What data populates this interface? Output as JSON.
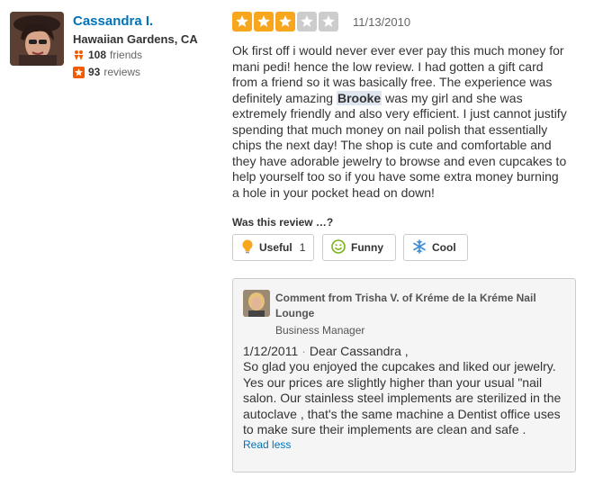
{
  "reviewer": {
    "name": "Cassandra I.",
    "location": "Hawaiian Gardens, CA",
    "friends_count": "108",
    "friends_label": "friends",
    "reviews_count": "93",
    "reviews_label": "reviews"
  },
  "review": {
    "rating": 3,
    "rating_max": 5,
    "date": "11/13/2010",
    "text_before": "Ok first off i would never ever ever pay this much money for mani pedi! hence the low review.  I had gotten a gift card from a friend so it was basically free.   The experience was definitely amazing ",
    "highlight": "Brooke",
    "text_after": " was my girl and she was extremely friendly and also very efficient.  I just cannot justify spending that much money on nail polish that essentially chips the next day! The shop is cute and comfortable and they have adorable jewelry to browse and even cupcakes to help yourself too so if you have some extra money burning a hole in your pocket head on down!"
  },
  "votes": {
    "prompt": "Was this review …?",
    "useful_label": "Useful",
    "useful_count": "1",
    "funny_label": "Funny",
    "cool_label": "Cool"
  },
  "owner_comment": {
    "from": "Comment from Trisha V. of Kréme de la Kréme Nail Lounge",
    "role": "Business Manager",
    "date": "1/12/2011",
    "separator": "·",
    "body": "Dear Cassandra ,\nSo glad you enjoyed the cupcakes and liked our jewelry. Yes our prices are slightly  higher than your usual \"nail salon.  Our stainless steel implements are sterilized in the autoclave , that's the same machine a Dentist office uses to make sure their implements are clean and safe .",
    "read_less": "Read less"
  },
  "colors": {
    "link": "#0073bb",
    "star_on": "#f8a61c",
    "star_off": "#cccccc"
  },
  "icons": {
    "friends": "friends-icon",
    "reviews": "review-star-icon",
    "useful": "lightbulb-icon",
    "funny": "smiley-icon",
    "cool": "snowflake-icon"
  }
}
